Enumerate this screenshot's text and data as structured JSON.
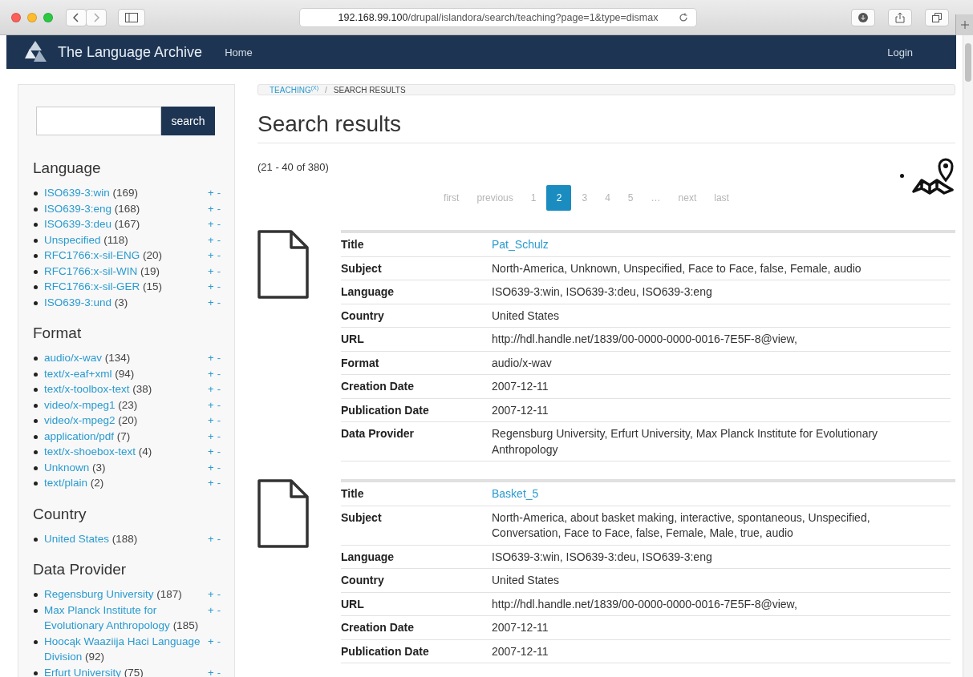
{
  "browser": {
    "url_host": "192.168.99.100",
    "url_path": "/drupal/islandora/search/teaching?page=1&type=dismax"
  },
  "navbar": {
    "brand": "The Language Archive",
    "links": [
      "Home"
    ],
    "login": "Login"
  },
  "sidebar": {
    "search": {
      "button": "search"
    },
    "facets": [
      {
        "heading": "Language",
        "items": [
          {
            "label": "ISO639-3:win",
            "count": "(169)",
            "add": "+",
            "remove": "-"
          },
          {
            "label": "ISO639-3:eng",
            "count": "(168)",
            "add": "+",
            "remove": "-"
          },
          {
            "label": "ISO639-3:deu",
            "count": "(167)",
            "add": "+",
            "remove": "-"
          },
          {
            "label": "Unspecified",
            "count": "(118)",
            "add": "+",
            "remove": "-"
          },
          {
            "label": "RFC1766:x-sil-ENG",
            "count": "(20)",
            "add": "+",
            "remove": "-"
          },
          {
            "label": "RFC1766:x-sil-WIN",
            "count": "(19)",
            "add": "+",
            "remove": "-"
          },
          {
            "label": "RFC1766:x-sil-GER",
            "count": "(15)",
            "add": "+",
            "remove": "-"
          },
          {
            "label": "ISO639-3:und",
            "count": "(3)",
            "add": "+",
            "remove": "-"
          }
        ]
      },
      {
        "heading": "Format",
        "items": [
          {
            "label": "audio/x-wav",
            "count": "(134)",
            "add": "+",
            "remove": "-"
          },
          {
            "label": "text/x-eaf+xml",
            "count": "(94)",
            "add": "+",
            "remove": "-"
          },
          {
            "label": "text/x-toolbox-text",
            "count": "(38)",
            "add": "+",
            "remove": "-"
          },
          {
            "label": "video/x-mpeg1",
            "count": "(23)",
            "add": "+",
            "remove": "-"
          },
          {
            "label": "video/x-mpeg2",
            "count": "(20)",
            "add": "+",
            "remove": "-"
          },
          {
            "label": "application/pdf",
            "count": "(7)",
            "add": "+",
            "remove": "-"
          },
          {
            "label": "text/x-shoebox-text",
            "count": "(4)",
            "add": "+",
            "remove": "-"
          },
          {
            "label": "Unknown",
            "count": "(3)",
            "add": "+",
            "remove": "-"
          },
          {
            "label": "text/plain",
            "count": "(2)",
            "add": "+",
            "remove": "-"
          }
        ]
      },
      {
        "heading": "Country",
        "items": [
          {
            "label": "United States",
            "count": "(188)",
            "add": "+",
            "remove": "-"
          }
        ]
      },
      {
        "heading": "Data Provider",
        "items": [
          {
            "label": "Regensburg University",
            "count": "(187)",
            "add": "+",
            "remove": "-"
          },
          {
            "label": "Max Planck Institute for Evolutionary Anthropology",
            "count": "(185)",
            "add": "+",
            "remove": "-"
          },
          {
            "label": "Hoocąk Waaziija Haci Language Division",
            "count": "(92)",
            "add": "+",
            "remove": "-"
          },
          {
            "label": "Erfurt University",
            "count": "(75)",
            "add": "+",
            "remove": "-"
          }
        ]
      }
    ]
  },
  "breadcrumb": {
    "link": "TEACHING$^{(X)}$",
    "separator": "/",
    "current": "SEARCH RESULTS"
  },
  "heading": "Search results",
  "result_count": "(21 - 40 of 380)",
  "pager": [
    {
      "label": "first",
      "selected": false
    },
    {
      "label": "previous",
      "selected": false
    },
    {
      "label": "1",
      "selected": false
    },
    {
      "label": "2",
      "selected": true
    },
    {
      "label": "3",
      "selected": false
    },
    {
      "label": "4",
      "selected": false
    },
    {
      "label": "5",
      "selected": false
    },
    {
      "label": "…",
      "selected": false
    },
    {
      "label": "next",
      "selected": false
    },
    {
      "label": "last",
      "selected": false
    }
  ],
  "results": [
    {
      "fields": [
        {
          "label": "Title",
          "value": "Pat_Schulz",
          "kind": "link"
        },
        {
          "label": "Subject",
          "value": "North-America, Unknown, Unspecified, Face to Face, false, Female, audio",
          "kind": "text"
        },
        {
          "label": "Language",
          "value": "ISO639-3:win, ISO639-3:deu, ISO639-3:eng",
          "kind": "text"
        },
        {
          "label": "Country",
          "value": "United States",
          "kind": "text"
        },
        {
          "label": "URL",
          "value": "http://hdl.handle.net/1839/00-0000-0000-0016-7E5F-8@view,",
          "kind": "text"
        },
        {
          "label": "Format",
          "value": "audio/x-wav",
          "kind": "text"
        },
        {
          "label": "Creation Date",
          "value": "2007-12-11",
          "kind": "text"
        },
        {
          "label": "Publication Date",
          "value": "2007-12-11",
          "kind": "text"
        },
        {
          "label": "Data Provider",
          "value": "Regensburg University, Erfurt University, Max Planck Institute for Evolutionary Anthropology",
          "kind": "text"
        }
      ]
    },
    {
      "fields": [
        {
          "label": "Title",
          "value": "Basket_5",
          "kind": "link"
        },
        {
          "label": "Subject",
          "value": "North-America, about basket making, interactive, spontaneous, Unspecified, Conversation, Face to Face, false, Female, Male, true, audio",
          "kind": "text"
        },
        {
          "label": "Language",
          "value": "ISO639-3:win, ISO639-3:deu, ISO639-3:eng",
          "kind": "text"
        },
        {
          "label": "Country",
          "value": "United States",
          "kind": "text"
        },
        {
          "label": "URL",
          "value": "http://hdl.handle.net/1839/00-0000-0000-0016-7E5F-8@view,",
          "kind": "text"
        },
        {
          "label": "Creation Date",
          "value": "2007-12-11",
          "kind": "text"
        },
        {
          "label": "Publication Date",
          "value": "2007-12-11",
          "kind": "text"
        }
      ]
    }
  ]
}
